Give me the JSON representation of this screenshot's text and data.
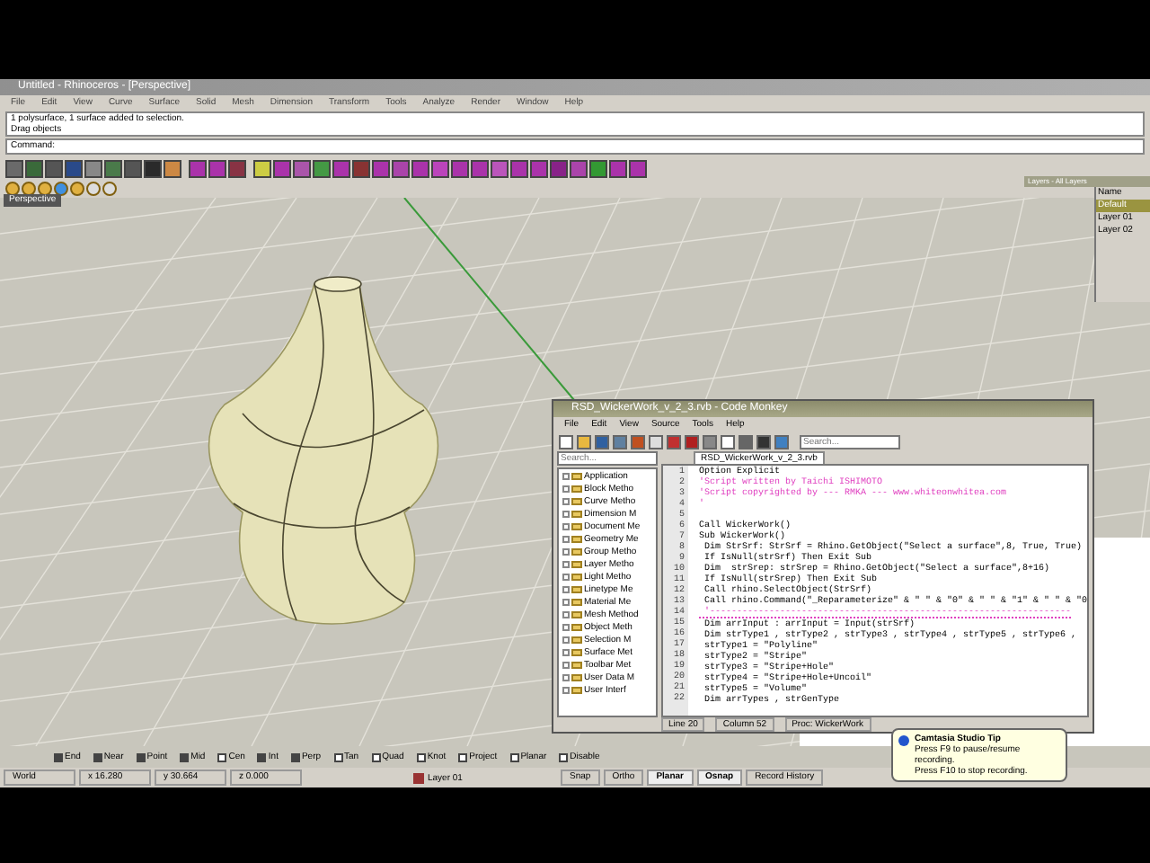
{
  "app_window": {
    "title": "Untitled - Rhinoceros - [Perspective]"
  },
  "menu": [
    "File",
    "Edit",
    "View",
    "Curve",
    "Surface",
    "Solid",
    "Mesh",
    "Dimension",
    "Transform",
    "Tools",
    "Analyze",
    "Render",
    "Window",
    "Help"
  ],
  "command_history": [
    "1 polysurface, 1 surface added to selection.",
    "Drag objects"
  ],
  "command_prompt": "Command:",
  "viewport": {
    "label": "Perspective"
  },
  "layers_panel": {
    "title": "Layers - All Layers",
    "items": [
      {
        "name": "Name",
        "selected": false
      },
      {
        "name": "Default",
        "selected": true
      },
      {
        "name": "Layer 01",
        "selected": false
      },
      {
        "name": "Layer 02",
        "selected": false
      }
    ]
  },
  "editor": {
    "title": "RSD_WickerWork_v_2_3.rvb - Code Monkey",
    "menu": [
      "File",
      "Edit",
      "View",
      "Source",
      "Tools",
      "Help"
    ],
    "search": {
      "placeholder": "Search..."
    },
    "tree_search": {
      "placeholder": "Search..."
    },
    "tab": "RSD_WickerWork_v_2_3.rvb",
    "tree": [
      {
        "label": "Application",
        "expanded": false
      },
      {
        "label": "Block Metho",
        "expanded": false
      },
      {
        "label": "Curve Metho",
        "expanded": false
      },
      {
        "label": "Dimension M",
        "expanded": false
      },
      {
        "label": "Document Me",
        "expanded": false
      },
      {
        "label": "Geometry Me",
        "expanded": false
      },
      {
        "label": "Group Metho",
        "expanded": false
      },
      {
        "label": "Layer Metho",
        "expanded": false
      },
      {
        "label": "Light Metho",
        "expanded": false
      },
      {
        "label": "Linetype Me",
        "expanded": false
      },
      {
        "label": "Material Me",
        "expanded": false
      },
      {
        "label": "Mesh Method",
        "expanded": false
      },
      {
        "label": "Object Meth",
        "expanded": false
      },
      {
        "label": "Selection M",
        "expanded": false
      },
      {
        "label": "Surface Met",
        "expanded": false
      },
      {
        "label": "Toolbar Met",
        "expanded": false
      },
      {
        "label": "User Data M",
        "expanded": false
      },
      {
        "label": "User Interf",
        "expanded": false
      }
    ],
    "code": [
      {
        "number": "1",
        "kind": "code",
        "text": "Option Explicit"
      },
      {
        "number": "2",
        "kind": "comment",
        "text": "'Script written by Taichi ISHIMOTO"
      },
      {
        "number": "3",
        "kind": "comment",
        "text": "'Script copyrighted by --- RMKA --- www.whiteonwhitea.com"
      },
      {
        "number": "4",
        "kind": "comment",
        "text": "'"
      },
      {
        "number": "5",
        "kind": "code"
      },
      {
        "number": "6",
        "kind": "code",
        "text": "Call WickerWork()"
      },
      {
        "number": "7",
        "kind": "code",
        "text": "Sub WickerWork()"
      },
      {
        "number": "8",
        "kind": "code",
        "text": " Dim StrSrf: StrSrf = Rhino.GetObject(\"Select a surface\",8, True, True)"
      },
      {
        "number": "9",
        "kind": "code",
        "text": " If IsNull(strSrf) Then Exit Sub"
      },
      {
        "number": "10",
        "kind": "code",
        "text": " Dim  strSrep: strSrep = Rhino.GetObject(\"Select a surface\",8+16)"
      },
      {
        "number": "11",
        "kind": "code",
        "text": " If IsNull(strSrep) Then Exit Sub"
      },
      {
        "number": "12",
        "kind": "code",
        "text": " Call rhino.SelectObject(StrSrf)"
      },
      {
        "number": "13",
        "kind": "code",
        "text": " Call rhino.Command(\"_Reparameterize\" & \" \" & \"0\" & \" \" & \"1\" & \" \" & \"0"
      },
      {
        "number": "14",
        "kind": "separator",
        "text": " '-------------------------------------------------------------------"
      },
      {
        "number": "15",
        "kind": "code",
        "text": " Dim arrInput : arrInput = Input(strSrf)"
      },
      {
        "number": "16",
        "kind": "code",
        "text": " Dim strType1 , strType2 , strType3 , strType4 , strType5 , strType6 ,"
      },
      {
        "number": "17",
        "kind": "code",
        "text": " strType1 = \"Polyline\""
      },
      {
        "number": "18",
        "kind": "code",
        "text": " strType2 = \"Stripe\""
      },
      {
        "number": "19",
        "kind": "code",
        "text": " strType3 = \"Stripe+Hole\""
      },
      {
        "number": "20",
        "kind": "code",
        "text": " strType4 = \"Stripe+Hole+Uncoil\""
      },
      {
        "number": "21",
        "kind": "code",
        "text": " strType5 = \"Volume\""
      },
      {
        "number": "22",
        "kind": "code",
        "text": " Dim arrTypes , strGenType"
      }
    ],
    "status": [
      "Line 20",
      "Column 52",
      "Proc: WickerWork"
    ]
  },
  "osnaps": [
    {
      "label": "End",
      "checked": true
    },
    {
      "label": "Near",
      "checked": true
    },
    {
      "label": "Point",
      "checked": true
    },
    {
      "label": "Mid",
      "checked": true
    },
    {
      "label": "Cen",
      "checked": false
    },
    {
      "label": "Int",
      "checked": true
    },
    {
      "label": "Perp",
      "checked": true
    },
    {
      "label": "Tan",
      "checked": false
    },
    {
      "label": "Quad",
      "checked": false
    },
    {
      "label": "Knot",
      "checked": false
    },
    {
      "label": "Project",
      "checked": false
    },
    {
      "label": "Planar",
      "checked": false
    },
    {
      "label": "Disable",
      "checked": false
    }
  ],
  "status_bar": {
    "coords": [
      "World",
      "x 16.280",
      "y 30.664",
      "z 0.000"
    ],
    "layer": {
      "name": "Layer 01",
      "color": "#993333"
    },
    "panes": [
      {
        "label": "Snap",
        "on": false
      },
      {
        "label": "Ortho",
        "on": false
      },
      {
        "label": "Planar",
        "on": true
      },
      {
        "label": "Osnap",
        "on": true
      },
      {
        "label": "Record History",
        "on": false
      }
    ]
  },
  "tip": {
    "title": "Camtasia Studio Tip",
    "lines": [
      "Press F9 to pause/resume recording.",
      "Press F10 to stop recording."
    ]
  }
}
